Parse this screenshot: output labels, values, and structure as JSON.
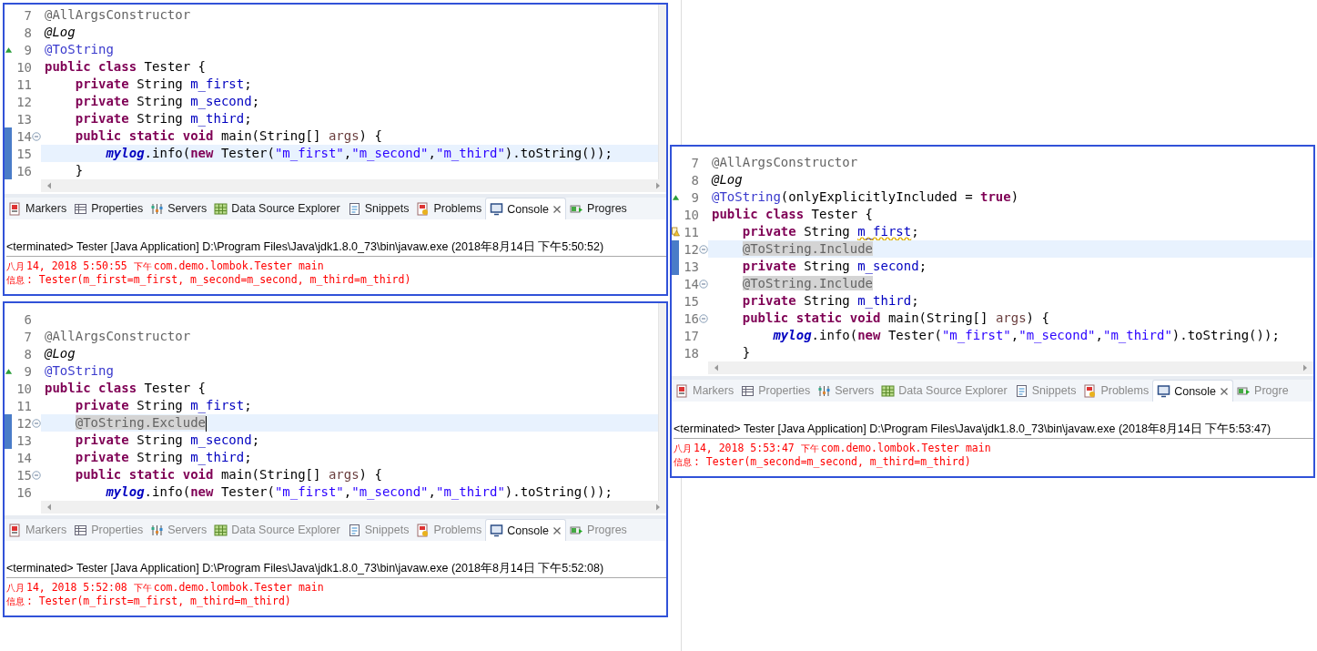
{
  "panels": [
    {
      "view_active": true,
      "lines": [
        {
          "number": "7",
          "tokens": [
            {
              "kind": "annotation-unused",
              "text": "@AllArgsConstructor"
            }
          ]
        },
        {
          "number": "8",
          "tokens": [
            {
              "kind": "italic",
              "text": "@Log"
            }
          ]
        },
        {
          "number": "9",
          "override": true,
          "tokens": [
            {
              "kind": "annotation",
              "text": "@ToString"
            }
          ]
        },
        {
          "number": "10",
          "tokens": [
            {
              "kind": "keyword",
              "text": "public class"
            },
            {
              "kind": "plain",
              "text": " Tester {"
            }
          ]
        },
        {
          "number": "11",
          "tokens": [
            {
              "kind": "keyword",
              "text": "    private"
            },
            {
              "kind": "plain",
              "text": " String "
            },
            {
              "kind": "field",
              "text": "m_first"
            },
            {
              "kind": "plain",
              "text": ";"
            }
          ]
        },
        {
          "number": "12",
          "tokens": [
            {
              "kind": "keyword",
              "text": "    private"
            },
            {
              "kind": "plain",
              "text": " String "
            },
            {
              "kind": "field",
              "text": "m_second"
            },
            {
              "kind": "plain",
              "text": ";"
            }
          ]
        },
        {
          "number": "13",
          "tokens": [
            {
              "kind": "keyword",
              "text": "    private"
            },
            {
              "kind": "plain",
              "text": " String "
            },
            {
              "kind": "field",
              "text": "m_third"
            },
            {
              "kind": "plain",
              "text": ";"
            }
          ]
        },
        {
          "number": "14",
          "foldable": true,
          "changed": true,
          "tokens": [
            {
              "kind": "keyword",
              "text": "    public static void"
            },
            {
              "kind": "plain",
              "text": " main(String[] "
            },
            {
              "kind": "param",
              "text": "args"
            },
            {
              "kind": "plain",
              "text": ") {"
            }
          ]
        },
        {
          "number": "15",
          "changed": true,
          "highlighted": true,
          "tokens": [
            {
              "kind": "static",
              "text": "        mylog"
            },
            {
              "kind": "plain",
              "text": ".info("
            },
            {
              "kind": "keyword",
              "text": "new"
            },
            {
              "kind": "plain",
              "text": " Tester("
            },
            {
              "kind": "string",
              "text": "\"m_first\""
            },
            {
              "kind": "plain",
              "text": ","
            },
            {
              "kind": "string",
              "text": "\"m_second\""
            },
            {
              "kind": "plain",
              "text": ","
            },
            {
              "kind": "string",
              "text": "\"m_third\""
            },
            {
              "kind": "plain",
              "text": ").toString());"
            }
          ]
        },
        {
          "number": "16",
          "changed": true,
          "tokens": [
            {
              "kind": "plain",
              "text": "    }"
            }
          ]
        }
      ],
      "tabs": [
        {
          "kind": "markers",
          "label": "Markers",
          "selected": false
        },
        {
          "kind": "properties",
          "label": "Properties",
          "selected": false
        },
        {
          "kind": "servers",
          "label": "Servers",
          "selected": false
        },
        {
          "kind": "datasource",
          "label": "Data Source Explorer",
          "selected": false
        },
        {
          "kind": "snippets",
          "label": "Snippets",
          "selected": false
        },
        {
          "kind": "problems",
          "label": "Problems",
          "selected": false
        },
        {
          "kind": "console",
          "label": "Console",
          "selected": true
        },
        {
          "kind": "progress",
          "label": "Progres",
          "selected": false
        }
      ],
      "console": {
        "header": "<terminated> Tester [Java Application] D:\\Program Files\\Java\\jdk1.8.0_73\\bin\\javaw.exe (2018年8月14日 下午5:50:52)",
        "log": [
          [
            {
              "kind": "cjk",
              "text": "八月"
            },
            {
              "kind": "plain",
              "text": "14, 2018 5:50:55 "
            },
            {
              "kind": "cjk",
              "text": "下午"
            },
            {
              "kind": "plain",
              "text": "com.demo.lombok.Tester main"
            }
          ],
          [
            {
              "kind": "cjk",
              "text": "信息"
            },
            {
              "kind": "plain",
              "text": ": Tester(m_first=m_first, m_second=m_second, m_third=m_third)"
            }
          ]
        ]
      }
    },
    {
      "view_active": false,
      "lines": [
        {
          "number": "6"
        },
        {
          "number": "7",
          "tokens": [
            {
              "kind": "annotation-unused",
              "text": "@AllArgsConstructor"
            }
          ]
        },
        {
          "number": "8",
          "tokens": [
            {
              "kind": "italic",
              "text": "@Log"
            }
          ]
        },
        {
          "number": "9",
          "override": true,
          "tokens": [
            {
              "kind": "annotation",
              "text": "@ToString"
            }
          ]
        },
        {
          "number": "10",
          "tokens": [
            {
              "kind": "keyword",
              "text": "public class"
            },
            {
              "kind": "plain",
              "text": " Tester {"
            }
          ]
        },
        {
          "number": "11",
          "tokens": [
            {
              "kind": "keyword",
              "text": "    private"
            },
            {
              "kind": "plain",
              "text": " String "
            },
            {
              "kind": "field",
              "text": "m_first"
            },
            {
              "kind": "plain",
              "text": ";"
            }
          ]
        },
        {
          "number": "12",
          "foldable": true,
          "changed": true,
          "highlighted": true,
          "cursor": true,
          "tokens": [
            {
              "kind": "marked",
              "text": "    @ToString.Exclude"
            }
          ]
        },
        {
          "number": "13",
          "changed": true,
          "tokens": [
            {
              "kind": "keyword",
              "text": "    private"
            },
            {
              "kind": "plain",
              "text": " String "
            },
            {
              "kind": "field",
              "text": "m_second"
            },
            {
              "kind": "plain",
              "text": ";"
            }
          ]
        },
        {
          "number": "14",
          "tokens": [
            {
              "kind": "keyword",
              "text": "    private"
            },
            {
              "kind": "plain",
              "text": " String "
            },
            {
              "kind": "field",
              "text": "m_third"
            },
            {
              "kind": "plain",
              "text": ";"
            }
          ]
        },
        {
          "number": "15",
          "foldable": true,
          "tokens": [
            {
              "kind": "keyword",
              "text": "    public static void"
            },
            {
              "kind": "plain",
              "text": " main(String[] "
            },
            {
              "kind": "param",
              "text": "args"
            },
            {
              "kind": "plain",
              "text": ") {"
            }
          ]
        },
        {
          "number": "16",
          "tokens": [
            {
              "kind": "static",
              "text": "        mylog"
            },
            {
              "kind": "plain",
              "text": ".info("
            },
            {
              "kind": "keyword",
              "text": "new"
            },
            {
              "kind": "plain",
              "text": " Tester("
            },
            {
              "kind": "string",
              "text": "\"m_first\""
            },
            {
              "kind": "plain",
              "text": ","
            },
            {
              "kind": "string",
              "text": "\"m_second\""
            },
            {
              "kind": "plain",
              "text": ","
            },
            {
              "kind": "string",
              "text": "\"m_third\""
            },
            {
              "kind": "plain",
              "text": ").toString());"
            }
          ]
        }
      ],
      "tabs": [
        {
          "kind": "markers",
          "label": "Markers",
          "selected": false
        },
        {
          "kind": "properties",
          "label": "Properties",
          "selected": false
        },
        {
          "kind": "servers",
          "label": "Servers",
          "selected": false
        },
        {
          "kind": "datasource",
          "label": "Data Source Explorer",
          "selected": false
        },
        {
          "kind": "snippets",
          "label": "Snippets",
          "selected": false
        },
        {
          "kind": "problems",
          "label": "Problems",
          "selected": false
        },
        {
          "kind": "console",
          "label": "Console",
          "selected": true
        },
        {
          "kind": "progress",
          "label": "Progres",
          "selected": false
        }
      ],
      "console": {
        "header": "<terminated> Tester [Java Application] D:\\Program Files\\Java\\jdk1.8.0_73\\bin\\javaw.exe (2018年8月14日 下午5:52:08)",
        "log": [
          [
            {
              "kind": "cjk",
              "text": "八月"
            },
            {
              "kind": "plain",
              "text": "14, 2018 5:52:08 "
            },
            {
              "kind": "cjk",
              "text": "下午"
            },
            {
              "kind": "plain",
              "text": "com.demo.lombok.Tester main"
            }
          ],
          [
            {
              "kind": "cjk",
              "text": "信息"
            },
            {
              "kind": "plain",
              "text": ": Tester(m_first=m_first, m_third=m_third)"
            }
          ]
        ]
      }
    },
    {
      "view_active": false,
      "lines": [
        {
          "number": "7",
          "tokens": [
            {
              "kind": "annotation-unused",
              "text": "@AllArgsConstructor"
            }
          ]
        },
        {
          "number": "8",
          "tokens": [
            {
              "kind": "italic",
              "text": "@Log"
            }
          ]
        },
        {
          "number": "9",
          "override": true,
          "tokens": [
            {
              "kind": "annotation",
              "text": "@ToString"
            },
            {
              "kind": "plain",
              "text": "(onlyExplicitlyIncluded = "
            },
            {
              "kind": "keyword",
              "text": "true"
            },
            {
              "kind": "plain",
              "text": ")"
            }
          ]
        },
        {
          "number": "10",
          "tokens": [
            {
              "kind": "keyword",
              "text": "public class"
            },
            {
              "kind": "plain",
              "text": " Tester {"
            }
          ]
        },
        {
          "number": "11",
          "warning": true,
          "tokens": [
            {
              "kind": "keyword",
              "text": "    private"
            },
            {
              "kind": "plain",
              "text": " String "
            },
            {
              "kind": "field-warning",
              "text": "m_first"
            },
            {
              "kind": "plain",
              "text": ";"
            }
          ]
        },
        {
          "number": "12",
          "foldable": true,
          "changed": true,
          "highlighted": true,
          "tokens": [
            {
              "kind": "marked",
              "text": "    @ToString.Include"
            }
          ]
        },
        {
          "number": "13",
          "changed": true,
          "tokens": [
            {
              "kind": "keyword",
              "text": "    private"
            },
            {
              "kind": "plain",
              "text": " String "
            },
            {
              "kind": "field",
              "text": "m_second"
            },
            {
              "kind": "plain",
              "text": ";"
            }
          ]
        },
        {
          "number": "14",
          "foldable": true,
          "tokens": [
            {
              "kind": "marked",
              "text": "    @ToString.Include"
            }
          ]
        },
        {
          "number": "15",
          "tokens": [
            {
              "kind": "keyword",
              "text": "    private"
            },
            {
              "kind": "plain",
              "text": " String "
            },
            {
              "kind": "field",
              "text": "m_third"
            },
            {
              "kind": "plain",
              "text": ";"
            }
          ]
        },
        {
          "number": "16",
          "foldable": true,
          "tokens": [
            {
              "kind": "keyword",
              "text": "    public static void"
            },
            {
              "kind": "plain",
              "text": " main(String[] "
            },
            {
              "kind": "param",
              "text": "args"
            },
            {
              "kind": "plain",
              "text": ") {"
            }
          ]
        },
        {
          "number": "17",
          "tokens": [
            {
              "kind": "static",
              "text": "        mylog"
            },
            {
              "kind": "plain",
              "text": ".info("
            },
            {
              "kind": "keyword",
              "text": "new"
            },
            {
              "kind": "plain",
              "text": " Tester("
            },
            {
              "kind": "string",
              "text": "\"m_first\""
            },
            {
              "kind": "plain",
              "text": ","
            },
            {
              "kind": "string",
              "text": "\"m_second\""
            },
            {
              "kind": "plain",
              "text": ","
            },
            {
              "kind": "string",
              "text": "\"m_third\""
            },
            {
              "kind": "plain",
              "text": ").toString());"
            }
          ]
        },
        {
          "number": "18",
          "tokens": [
            {
              "kind": "plain",
              "text": "    }"
            }
          ]
        }
      ],
      "tabs": [
        {
          "kind": "markers",
          "label": "Markers",
          "selected": false
        },
        {
          "kind": "properties",
          "label": "Properties",
          "selected": false
        },
        {
          "kind": "servers",
          "label": "Servers",
          "selected": false
        },
        {
          "kind": "datasource",
          "label": "Data Source Explorer",
          "selected": false
        },
        {
          "kind": "snippets",
          "label": "Snippets",
          "selected": false
        },
        {
          "kind": "problems",
          "label": "Problems",
          "selected": false
        },
        {
          "kind": "console",
          "label": "Console",
          "selected": true
        },
        {
          "kind": "progress",
          "label": "Progre",
          "selected": false
        }
      ],
      "console": {
        "header": "<terminated> Tester [Java Application] D:\\Program Files\\Java\\jdk1.8.0_73\\bin\\javaw.exe (2018年8月14日 下午5:53:47)",
        "log": [
          [
            {
              "kind": "cjk",
              "text": "八月"
            },
            {
              "kind": "plain",
              "text": "14, 2018 5:53:47 "
            },
            {
              "kind": "cjk",
              "text": "下午"
            },
            {
              "kind": "plain",
              "text": "com.demo.lombok.Tester main"
            }
          ],
          [
            {
              "kind": "cjk",
              "text": "信息"
            },
            {
              "kind": "plain",
              "text": ": Tester(m_second=m_second, m_third=m_third)"
            }
          ]
        ]
      }
    }
  ]
}
